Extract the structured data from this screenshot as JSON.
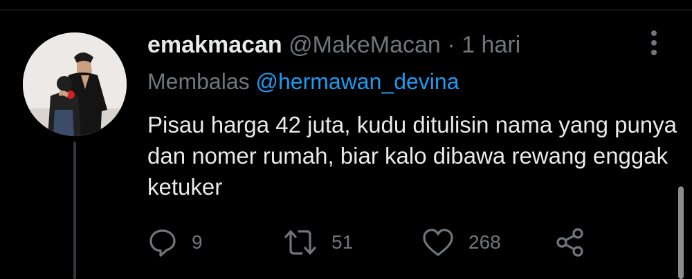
{
  "tweet": {
    "author_name": "emakmacan",
    "author_handle": "@MakeMacan",
    "separator": "·",
    "timestamp": "1 hari",
    "reply_prefix": "Membalas",
    "reply_to": "@hermawan_devina",
    "text": "Pisau harga 42 juta, kudu ditulisin nama yang punya dan nomer rumah, biar kalo dibawa rewang enggak ketuker"
  },
  "actions": {
    "reply_count": "9",
    "retweet_count": "51",
    "like_count": "268"
  },
  "icons": {
    "more": "more-vertical-icon",
    "reply": "reply-icon",
    "retweet": "retweet-icon",
    "like": "heart-icon",
    "share": "share-icon"
  },
  "colors": {
    "background": "#000000",
    "primary_text": "#e7e9ea",
    "secondary_text": "#71767b",
    "accent": "#1d9bf0",
    "thread_line": "#333639"
  }
}
